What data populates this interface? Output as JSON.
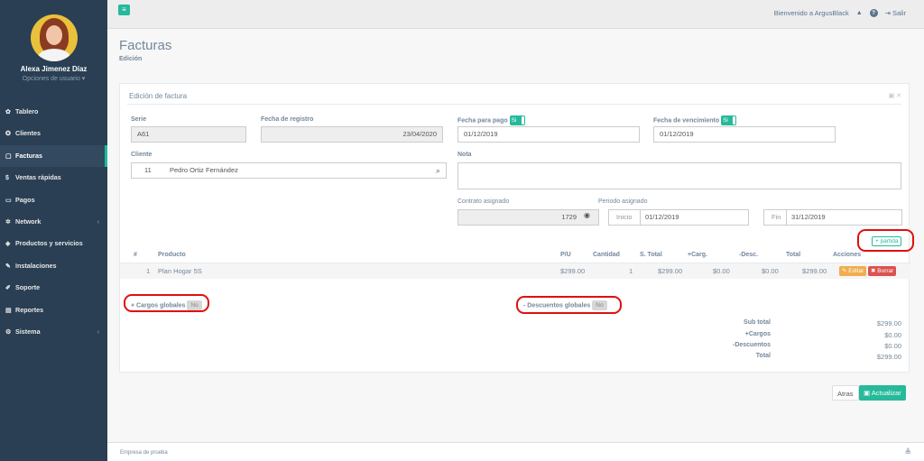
{
  "user": {
    "name": "Alexa Jimenez Díaz",
    "options": "Opciones de usuario ▾"
  },
  "sidebar": {
    "items": [
      {
        "icon": "✿",
        "label": "Tablero"
      },
      {
        "icon": "✪",
        "label": "Clientes"
      },
      {
        "icon": "▢",
        "label": "Facturas",
        "active": true
      },
      {
        "icon": "$",
        "label": "Ventas rápidas"
      },
      {
        "icon": "▭",
        "label": "Pagos"
      },
      {
        "icon": "✲",
        "label": "Network",
        "chevron": "‹"
      },
      {
        "icon": "◈",
        "label": "Productos y servicios"
      },
      {
        "icon": "✎",
        "label": "Instalaciones"
      },
      {
        "icon": "✐",
        "label": "Soporte"
      },
      {
        "icon": "▤",
        "label": "Reportes"
      },
      {
        "icon": "⚙",
        "label": "Sistema",
        "chevron": "‹"
      }
    ]
  },
  "topbar": {
    "menu_icon": "≡",
    "welcome": "Bienvenido a ArgusBlack",
    "bell": "🔔",
    "help": "?",
    "logout": "⇥ Salir"
  },
  "page": {
    "title": "Facturas",
    "subtitle": "Edición"
  },
  "panel": {
    "title": "Edición de factura",
    "tools": "▣ ✕",
    "serie": {
      "label": "Serie",
      "value": "A61"
    },
    "fecha_registro": {
      "label": "Fecha de registro",
      "value": "23/04/2020"
    },
    "fecha_pago": {
      "label": "Fecha para pago",
      "switch": "Si",
      "value": "01/12/2019"
    },
    "fecha_venc": {
      "label": "Fecha de vencimiento",
      "switch": "Si",
      "value": "01/12/2019"
    },
    "cliente": {
      "label": "Cliente",
      "id": "11",
      "name": "Pedro Ortiz Fernández",
      "search": "⌕"
    },
    "nota": {
      "label": "Nota",
      "value": ""
    },
    "contrato": {
      "label": "Contrato asignado",
      "value": "1729",
      "eye": "👁"
    },
    "periodo": {
      "label": "Periodo asignado",
      "inicio_label": "Inicio",
      "inicio": "01/12/2019",
      "fin_label": "Fin",
      "fin": "31/12/2019"
    },
    "add_partida": "+ partida",
    "table": {
      "headers": [
        "#",
        "Producto",
        "P/U",
        "Cantidad",
        "S. Total",
        "+Carg.",
        "-Desc.",
        "Total",
        "Acciones"
      ],
      "rows": [
        {
          "num": "1",
          "producto": "Plan Hogar 5S",
          "pu": "$299.00",
          "cantidad": "1",
          "stotal": "$299.00",
          "carg": "$0.00",
          "desc": "$0.00",
          "total": "$299.00"
        }
      ],
      "edit": "✎ Editar",
      "delete": "✖ Borrar"
    },
    "cargos": {
      "label": "+ Cargos globales",
      "switch": "No"
    },
    "descuentos": {
      "label": "- Descuentos globales",
      "switch": "No"
    },
    "totals": {
      "subtotal_label": "Sub total",
      "subtotal": "$299.00",
      "cargos_label": "+Cargos",
      "cargos": "$0.00",
      "descuentos_label": "-Descuentos",
      "descuentos": "$0.00",
      "total_label": "Total",
      "total": "$299.00"
    }
  },
  "actions": {
    "back": "Atras",
    "update": "▣ Actualizar"
  },
  "footer": {
    "company": "Empresa de prueba",
    "icon": "≜"
  },
  "colors": {
    "sidebar": "#2a3f54",
    "accent": "#26b99a",
    "danger": "#d9534f",
    "warning": "#f0ad4e",
    "annotation": "#e01010"
  }
}
